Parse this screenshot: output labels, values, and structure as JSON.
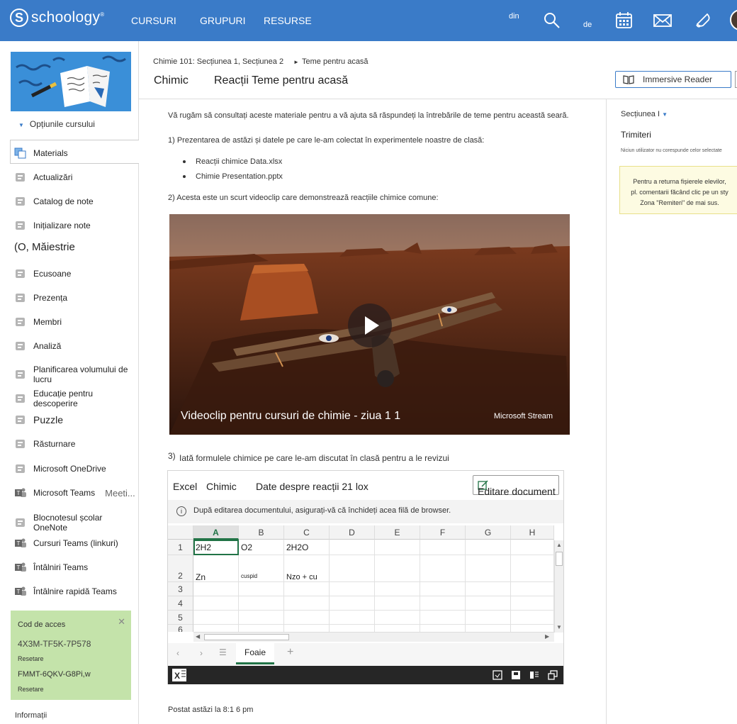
{
  "topbar": {
    "logo_text": "schoology",
    "logo_mark": "S",
    "nav": [
      "CURSURI",
      "GRUPURI",
      "RESURSE"
    ],
    "small_din": "din",
    "small_de": "de",
    "icons": [
      "search-icon",
      "calendar-icon",
      "mail-icon",
      "bell-icon"
    ]
  },
  "sidebar": {
    "options_label": "Opțiunile cursului",
    "items": [
      {
        "label": "Materials",
        "icon": "materials-icon"
      },
      {
        "label": "Actualizări",
        "icon": "updates-icon"
      },
      {
        "label": "Catalog de note",
        "icon": "gradebook-icon"
      },
      {
        "label": "Inițializare note",
        "icon": "grade-setup-icon"
      },
      {
        "label": "(O, Măiestrie",
        "icon": ""
      },
      {
        "label": "Ecusoane",
        "icon": "badge-icon"
      },
      {
        "label": "Prezența",
        "icon": "attendance-icon"
      },
      {
        "label": "Membri",
        "icon": "members-icon"
      },
      {
        "label": "Analiză",
        "icon": "analytics-icon"
      },
      {
        "label": "Planificarea volumului de lucru",
        "icon": "workload-icon"
      },
      {
        "label": "Educație pentru descoperire",
        "icon": "discovery-icon"
      },
      {
        "label": "Puzzle",
        "icon": "puzzle-icon"
      },
      {
        "label": "Răsturnare",
        "icon": "flip-icon"
      },
      {
        "label": "Microsoft OneDrive",
        "icon": "onedrive-icon"
      },
      {
        "label": "Microsoft Teams",
        "icon": "teams-icon",
        "extra": "Meeti..."
      },
      {
        "label": "Blocnotesul școlar OneNote",
        "icon": "onenote-icon"
      },
      {
        "label": "Cursuri Teams (linkuri)",
        "icon": "teams-icon"
      },
      {
        "label": "Întâlniri Teams",
        "icon": "teams-icon"
      },
      {
        "label": "Întâlnire rapidă Teams",
        "icon": "teams-icon"
      }
    ],
    "access": {
      "title": "Cod de acces",
      "code1": "4X3M-TF5K-7P578",
      "reset1": "Resetare",
      "code2": "FMMT-6QKV-G8Pi,w",
      "reset2": "Resetare"
    },
    "info": "Informații"
  },
  "header": {
    "crumb1": "Chimie 101: Secțiunea 1, Secțiunea 2",
    "crumb2": "Teme pentru acasă",
    "title1": "Chimic",
    "title2": "Reacții Teme pentru acasă",
    "immersive": "Immersive Reader"
  },
  "content": {
    "intro": "Vă rugăm să consultați aceste materiale pentru a vă ajuta să răspundeți la întrebările de teme pentru această seară.",
    "p1": "1) Prezentarea de astăzi și datele pe care le-am colectat în experimentele noastre de clasă:",
    "files": [
      "Reacții chimice Data.xlsx",
      "Chimie Presentation.pptx"
    ],
    "p2": "2) Acesta este un scurt videoclip care demonstrează reacțiile chimice comune:",
    "video_title": "Videoclip pentru cursuri de chimie - ziua 1 1",
    "video_brand": "Microsoft Stream",
    "p3_num": "3)",
    "p3": "Iată formulele chimice pe care le-am discutat în clasă pentru a le revizui",
    "posted": "Postat astăzi la 8:1 6 pm"
  },
  "excel": {
    "app": "Excel",
    "file": "Chimic",
    "sheet_title": "Date despre reacții 21 lox",
    "edit_btn": "Editare document",
    "info": "După editarea documentului, asigurați-vă că închideți acea filă de browser.",
    "columns": [
      "A",
      "B",
      "C",
      "D",
      "E",
      "F",
      "G",
      "H"
    ],
    "rows": [
      "1",
      "2",
      "3",
      "4",
      "5",
      "6"
    ],
    "cells": {
      "a1": "2H2",
      "b1": "O2",
      "c1": "2H2O",
      "a2": "Zn",
      "b2": "cuspid",
      "c2": "Nzo + cu"
    },
    "sheet_tab": "Foaie"
  },
  "right_panel": {
    "section": "Secțiunea I",
    "submissions": "Trimiteri",
    "no_users": "Niciun utilizator nu corespunde celor selectate",
    "note_lines": [
      "Pentru a returna fișierele elevilor,",
      "pl. comentarii făcând clic pe un sty",
      "Zona \"Remiteri\" de mai sus."
    ]
  },
  "colors": {
    "topbar": "#3a7bc8",
    "access_box": "#c4e3aa",
    "excel_green": "#217346"
  }
}
